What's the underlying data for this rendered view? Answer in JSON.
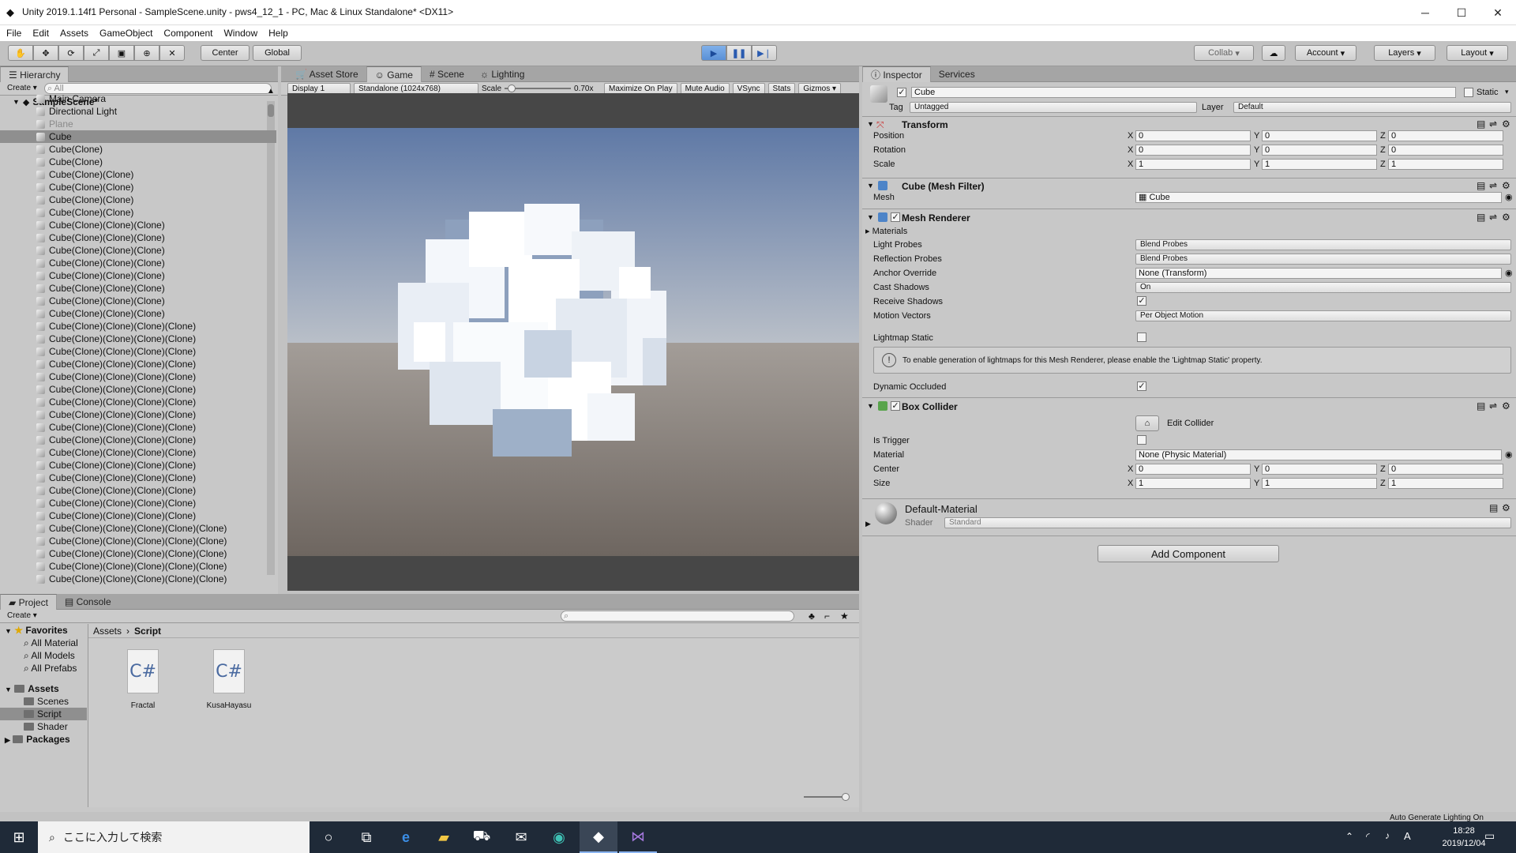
{
  "window": {
    "title": "Unity 2019.1.14f1 Personal - SampleScene.unity - pws4_12_1 - PC, Mac & Linux Standalone* <DX11>",
    "controls": [
      "─",
      "☐",
      "✕"
    ]
  },
  "menu": [
    "File",
    "Edit",
    "Assets",
    "GameObject",
    "Component",
    "Window",
    "Help"
  ],
  "toolbar": {
    "pivot": "Center",
    "space": "Global",
    "collab": "Collab",
    "account": "Account",
    "layers": "Layers",
    "layout": "Layout",
    "play_active": true
  },
  "hierarchy": {
    "tab": "Hierarchy",
    "create": "Create",
    "search_placeholder": "All",
    "scene": "SampleScene*",
    "items": [
      {
        "name": "Main Camera"
      },
      {
        "name": "Directional Light"
      },
      {
        "name": "Plane",
        "dim": true
      },
      {
        "name": "Cube",
        "selected": true
      },
      {
        "name": "Cube(Clone)"
      },
      {
        "name": "Cube(Clone)"
      },
      {
        "name": "Cube(Clone)(Clone)"
      },
      {
        "name": "Cube(Clone)(Clone)"
      },
      {
        "name": "Cube(Clone)(Clone)"
      },
      {
        "name": "Cube(Clone)(Clone)"
      },
      {
        "name": "Cube(Clone)(Clone)(Clone)"
      },
      {
        "name": "Cube(Clone)(Clone)(Clone)"
      },
      {
        "name": "Cube(Clone)(Clone)(Clone)"
      },
      {
        "name": "Cube(Clone)(Clone)(Clone)"
      },
      {
        "name": "Cube(Clone)(Clone)(Clone)"
      },
      {
        "name": "Cube(Clone)(Clone)(Clone)"
      },
      {
        "name": "Cube(Clone)(Clone)(Clone)"
      },
      {
        "name": "Cube(Clone)(Clone)(Clone)"
      },
      {
        "name": "Cube(Clone)(Clone)(Clone)(Clone)"
      },
      {
        "name": "Cube(Clone)(Clone)(Clone)(Clone)"
      },
      {
        "name": "Cube(Clone)(Clone)(Clone)(Clone)"
      },
      {
        "name": "Cube(Clone)(Clone)(Clone)(Clone)"
      },
      {
        "name": "Cube(Clone)(Clone)(Clone)(Clone)"
      },
      {
        "name": "Cube(Clone)(Clone)(Clone)(Clone)"
      },
      {
        "name": "Cube(Clone)(Clone)(Clone)(Clone)"
      },
      {
        "name": "Cube(Clone)(Clone)(Clone)(Clone)"
      },
      {
        "name": "Cube(Clone)(Clone)(Clone)(Clone)"
      },
      {
        "name": "Cube(Clone)(Clone)(Clone)(Clone)"
      },
      {
        "name": "Cube(Clone)(Clone)(Clone)(Clone)"
      },
      {
        "name": "Cube(Clone)(Clone)(Clone)(Clone)"
      },
      {
        "name": "Cube(Clone)(Clone)(Clone)(Clone)"
      },
      {
        "name": "Cube(Clone)(Clone)(Clone)(Clone)"
      },
      {
        "name": "Cube(Clone)(Clone)(Clone)(Clone)"
      },
      {
        "name": "Cube(Clone)(Clone)(Clone)(Clone)"
      },
      {
        "name": "Cube(Clone)(Clone)(Clone)(Clone)(Clone)"
      },
      {
        "name": "Cube(Clone)(Clone)(Clone)(Clone)(Clone)"
      },
      {
        "name": "Cube(Clone)(Clone)(Clone)(Clone)(Clone)"
      },
      {
        "name": "Cube(Clone)(Clone)(Clone)(Clone)(Clone)"
      },
      {
        "name": "Cube(Clone)(Clone)(Clone)(Clone)(Clone)"
      }
    ]
  },
  "center_tabs": [
    "Asset Store",
    "Game",
    "Scene",
    "Lighting"
  ],
  "game_bar": {
    "display": "Display 1",
    "resolution": "Standalone (1024x768)",
    "scale_label": "Scale",
    "scale_value": "0.70x",
    "scale_level": 0.05,
    "maximize": "Maximize On Play",
    "mute": "Mute Audio",
    "vsync": "VSync",
    "stats": "Stats",
    "gizmos": "Gizmos"
  },
  "inspector": {
    "tabs": [
      "Inspector",
      "Services"
    ],
    "object_name": "Cube",
    "static_label": "Static",
    "tag_label": "Tag",
    "tag": "Untagged",
    "layer_label": "Layer",
    "layer": "Default",
    "transform": {
      "title": "Transform",
      "rows": [
        {
          "label": "Position",
          "x": "0",
          "y": "0",
          "z": "0"
        },
        {
          "label": "Rotation",
          "x": "0",
          "y": "0",
          "z": "0"
        },
        {
          "label": "Scale",
          "x": "1",
          "y": "1",
          "z": "1"
        }
      ]
    },
    "mesh_filter": {
      "title": "Cube (Mesh Filter)",
      "mesh_label": "Mesh",
      "mesh": "Cube"
    },
    "mesh_renderer": {
      "title": "Mesh Renderer",
      "materials": "Materials",
      "light_probes_label": "Light Probes",
      "light_probes": "Blend Probes",
      "reflection_label": "Reflection Probes",
      "reflection": "Blend Probes",
      "anchor_label": "Anchor Override",
      "anchor": "None (Transform)",
      "cast_label": "Cast Shadows",
      "cast": "On",
      "receive_label": "Receive Shadows",
      "motion_label": "Motion Vectors",
      "motion": "Per Object Motion",
      "lightmap_label": "Lightmap Static",
      "info": "To enable generation of lightmaps for this Mesh Renderer, please enable the 'Lightmap Static' property.",
      "dynamic_label": "Dynamic Occluded"
    },
    "box_collider": {
      "title": "Box Collider",
      "edit": "Edit Collider",
      "trigger_label": "Is Trigger",
      "material_label": "Material",
      "material": "None (Physic Material)",
      "center_label": "Center",
      "center": {
        "x": "0",
        "y": "0",
        "z": "0"
      },
      "size_label": "Size",
      "size": {
        "x": "1",
        "y": "1",
        "z": "1"
      }
    },
    "material": {
      "name": "Default-Material",
      "shader_label": "Shader",
      "shader": "Standard"
    },
    "add_component": "Add Component"
  },
  "project": {
    "tabs": [
      "Project",
      "Console"
    ],
    "create": "Create",
    "favorites": "Favorites",
    "fav_items": [
      "All Material",
      "All Models",
      "All Prefabs"
    ],
    "assets": "Assets",
    "asset_folders": [
      "Scenes",
      "Script",
      "Shader"
    ],
    "packages": "Packages",
    "breadcrumb": [
      "Assets",
      "Script"
    ],
    "files": [
      {
        "name": "Fractal",
        "glyph": "C#"
      },
      {
        "name": "KusaHayasu",
        "glyph": "C#"
      }
    ]
  },
  "status": {
    "text": "Auto Generate Lighting On"
  },
  "taskbar": {
    "search_placeholder": "ここに入力して検索",
    "time": "18:28",
    "date": "2019/12/04",
    "ime": "A"
  },
  "colors": {
    "play_blue": "#5a90d6",
    "sky_top": "#5f79a6",
    "ground": "#6e6660"
  }
}
